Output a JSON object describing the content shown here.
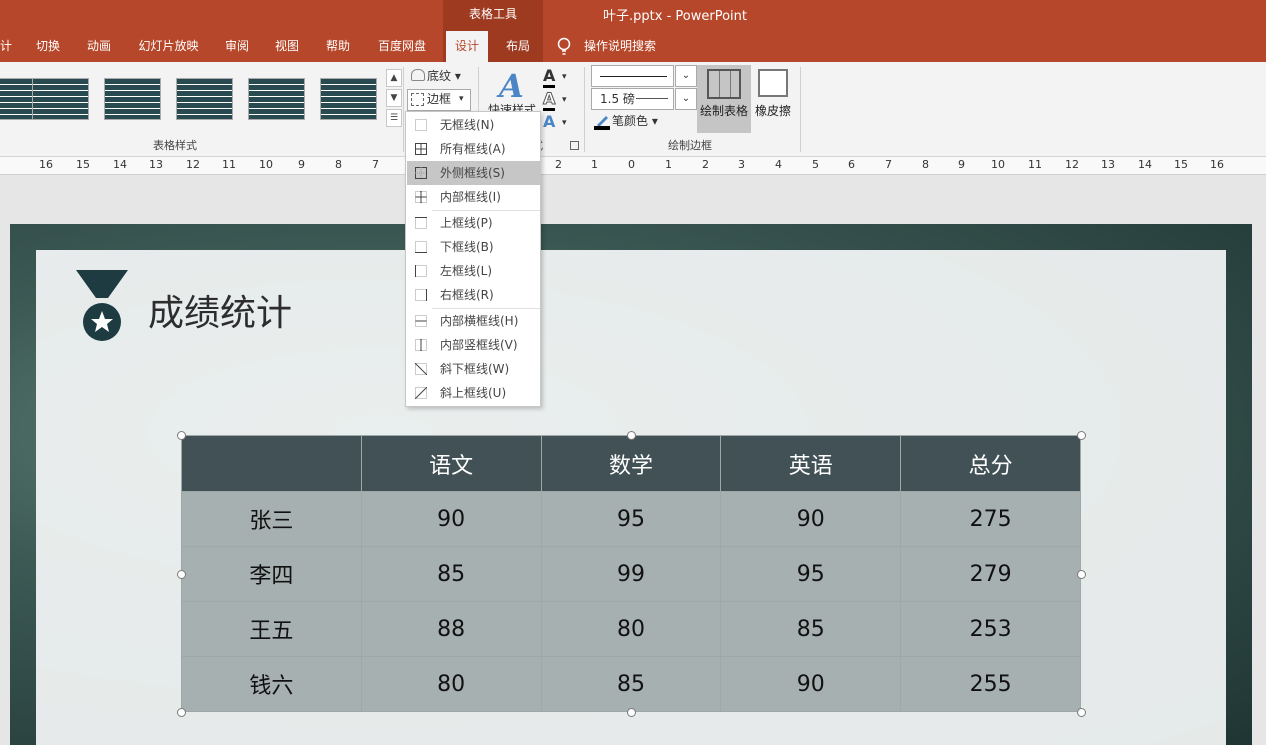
{
  "titlebar": {
    "context_label": "表格工具",
    "window_title": "叶子.pptx  -  PowerPoint"
  },
  "tabs": {
    "cut_partial": "计",
    "transitions": "切换",
    "animations": "动画",
    "slideshow": "幻灯片放映",
    "review": "审阅",
    "view": "视图",
    "help": "帮助",
    "baidu": "百度网盘",
    "design": "设计",
    "layout": "布局",
    "tell_me": "操作说明搜索"
  },
  "ribbon": {
    "table_styles_group": "表格样式",
    "shading": "底纹",
    "borders": "边框",
    "quick_styles": "快速样式",
    "wordart_group_partial": "式",
    "pen_weight": "1.5 磅",
    "pen_color": "笔颜色",
    "draw_table": "绘制表格",
    "eraser": "橡皮擦",
    "draw_borders_group": "绘制边框",
    "accent_color": "#b7472a"
  },
  "border_menu": {
    "items": [
      "无框线(N)",
      "所有框线(A)",
      "外侧框线(S)",
      "内部框线(I)",
      "上框线(P)",
      "下框线(B)",
      "左框线(L)",
      "右框线(R)",
      "内部横框线(H)",
      "内部竖框线(V)",
      "斜下框线(W)",
      "斜上框线(U)"
    ],
    "highlighted": "外侧框线(S)"
  },
  "ruler": {
    "labels": [
      "16",
      "15",
      "14",
      "13",
      "12",
      "11",
      "10",
      "9",
      "8",
      "7",
      "6",
      "5",
      "4",
      "3",
      "2",
      "1",
      "0",
      "1",
      "2",
      "3",
      "4",
      "5",
      "6",
      "7",
      "8",
      "9",
      "10",
      "11",
      "12",
      "13",
      "14",
      "15",
      "16"
    ]
  },
  "slide": {
    "title": "成绩统计",
    "table": {
      "headers": [
        "",
        "语文",
        "数学",
        "英语",
        "总分"
      ],
      "rows": [
        [
          "张三",
          "90",
          "95",
          "90",
          "275"
        ],
        [
          "李四",
          "85",
          "99",
          "95",
          "279"
        ],
        [
          "王五",
          "88",
          "80",
          "85",
          "253"
        ],
        [
          "钱六",
          "80",
          "85",
          "90",
          "255"
        ]
      ]
    }
  }
}
